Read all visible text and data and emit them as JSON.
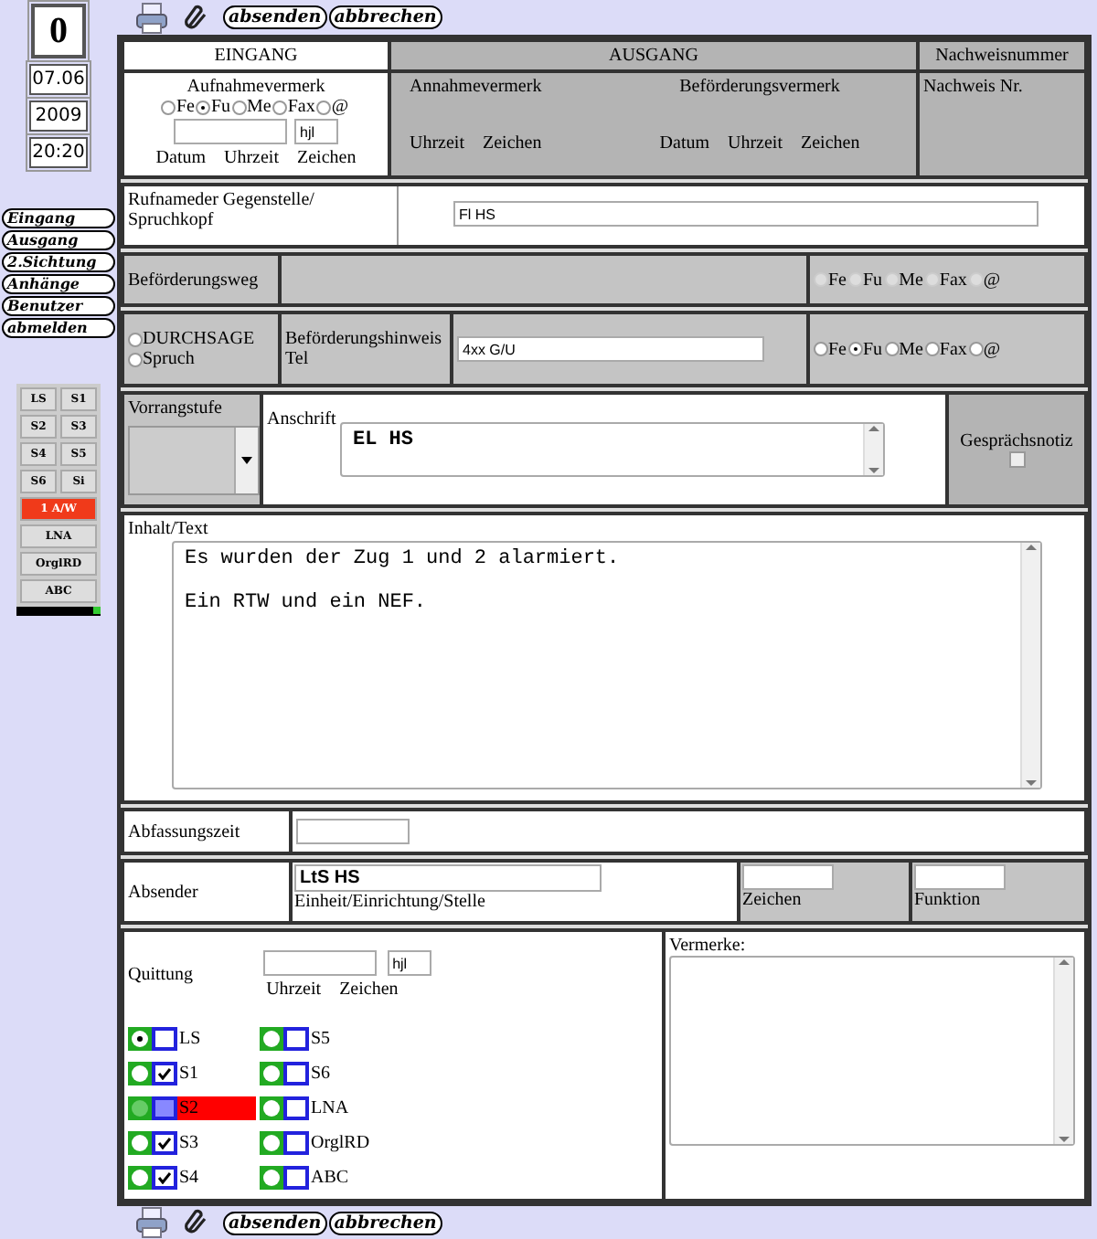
{
  "toolbar_top": {
    "buttons": [
      "absenden",
      "abbrechen"
    ]
  },
  "sidebar": {
    "counter": "0",
    "date": "07.06",
    "year": "2009",
    "time": "20:20",
    "nav": [
      "Eingang",
      "Ausgang",
      "2.Sichtung",
      "Anhänge",
      "Benutzer",
      "abmelden"
    ],
    "status": [
      {
        "label": "LS",
        "kind": "half",
        "alert": false
      },
      {
        "label": "S1",
        "kind": "half",
        "alert": false
      },
      {
        "label": "S2",
        "kind": "half",
        "alert": false
      },
      {
        "label": "S3",
        "kind": "half",
        "alert": false
      },
      {
        "label": "S4",
        "kind": "half",
        "alert": false
      },
      {
        "label": "S5",
        "kind": "half",
        "alert": false
      },
      {
        "label": "S6",
        "kind": "half",
        "alert": false
      },
      {
        "label": "Si",
        "kind": "half",
        "alert": false
      },
      {
        "label": "1 A/W",
        "kind": "full",
        "alert": true
      },
      {
        "label": "LNA",
        "kind": "full",
        "alert": false
      },
      {
        "label": "OrglRD",
        "kind": "full",
        "alert": false
      },
      {
        "label": "ABC",
        "kind": "full",
        "alert": false
      }
    ]
  },
  "header": {
    "eingang": {
      "title": "EINGANG",
      "vermerk": "Aufnahmevermerk",
      "radios": [
        {
          "label": "Fe",
          "selected": false
        },
        {
          "label": "Fu",
          "selected": true
        },
        {
          "label": "Me",
          "selected": false
        },
        {
          "label": "Fax",
          "selected": false
        },
        {
          "label": "@",
          "selected": false
        }
      ],
      "sign_value": "hjl",
      "captions": [
        "Datum",
        "Uhrzeit",
        "Zeichen"
      ]
    },
    "ausgang": {
      "title": "AUSGANG",
      "annahme": {
        "title": "Annahmevermerk",
        "captions": [
          "Uhrzeit",
          "Zeichen"
        ]
      },
      "befoerderung": {
        "title": "Beförderungsvermerk",
        "captions": [
          "Datum",
          "Uhrzeit",
          "Zeichen"
        ]
      }
    },
    "nachweis": {
      "title": "Nachweisnummer",
      "label": "Nachweis Nr."
    }
  },
  "rufname": {
    "label": "Rufnameder Gegenstelle/ Spruchkopf",
    "value": "Fl HS"
  },
  "befoerderungsweg": {
    "label": "Beförderungsweg",
    "disabled": true,
    "radios": [
      {
        "label": "Fe",
        "selected": false
      },
      {
        "label": "Fu",
        "selected": false
      },
      {
        "label": "Me",
        "selected": false
      },
      {
        "label": "Fax",
        "selected": false
      },
      {
        "label": "@",
        "selected": false
      }
    ]
  },
  "hinweis": {
    "modes": [
      {
        "label": "DURCHSAGE",
        "selected": false
      },
      {
        "label": "Spruch",
        "selected": false
      }
    ],
    "label": "Beförderungshinweis Tel",
    "value": "4xx G/U",
    "radios": [
      {
        "label": "Fe",
        "selected": false
      },
      {
        "label": "Fu",
        "selected": true
      },
      {
        "label": "Me",
        "selected": false
      },
      {
        "label": "Fax",
        "selected": false
      },
      {
        "label": "@",
        "selected": false
      }
    ]
  },
  "vorrang": {
    "label": "Vorrangstufe"
  },
  "anschrift": {
    "label": "Anschrift",
    "value": "EL HS"
  },
  "gespraechsnotiz": {
    "label": "Gesprächsnotiz",
    "checked": false
  },
  "inhalt": {
    "label": "Inhalt/Text",
    "paragraphs": [
      "Es wurden der Zug 1 und 2 alarmiert.",
      "Ein RTW und ein NEF."
    ]
  },
  "abfassungszeit": {
    "label": "Abfassungszeit"
  },
  "absender": {
    "label": "Absender",
    "value": "LtS HS",
    "caption": "Einheit/Einrichtung/Stelle",
    "zeichen": "Zeichen",
    "funktion": "Funktion"
  },
  "quittung": {
    "label": "Quittung",
    "sign_value": "hjl",
    "captions": [
      "Uhrzeit",
      "Zeichen"
    ],
    "recipients": [
      {
        "label": "LS",
        "selected": true,
        "checked": false,
        "alert": false
      },
      {
        "label": "S1",
        "selected": false,
        "checked": true,
        "alert": false
      },
      {
        "label": "S2",
        "selected": false,
        "checked": false,
        "alert": true
      },
      {
        "label": "S3",
        "selected": false,
        "checked": true,
        "alert": false
      },
      {
        "label": "S4",
        "selected": false,
        "checked": true,
        "alert": false
      },
      {
        "label": "S5",
        "selected": false,
        "checked": false,
        "alert": false
      },
      {
        "label": "S6",
        "selected": false,
        "checked": false,
        "alert": false
      },
      {
        "label": "LNA",
        "selected": false,
        "checked": false,
        "alert": false
      },
      {
        "label": "OrglRD",
        "selected": false,
        "checked": false,
        "alert": false
      },
      {
        "label": "ABC",
        "selected": false,
        "checked": false,
        "alert": false
      }
    ]
  },
  "vermerke": {
    "label": "Vermerke:"
  },
  "toolbar_bottom": {
    "buttons": [
      "absenden",
      "abbrechen"
    ]
  }
}
